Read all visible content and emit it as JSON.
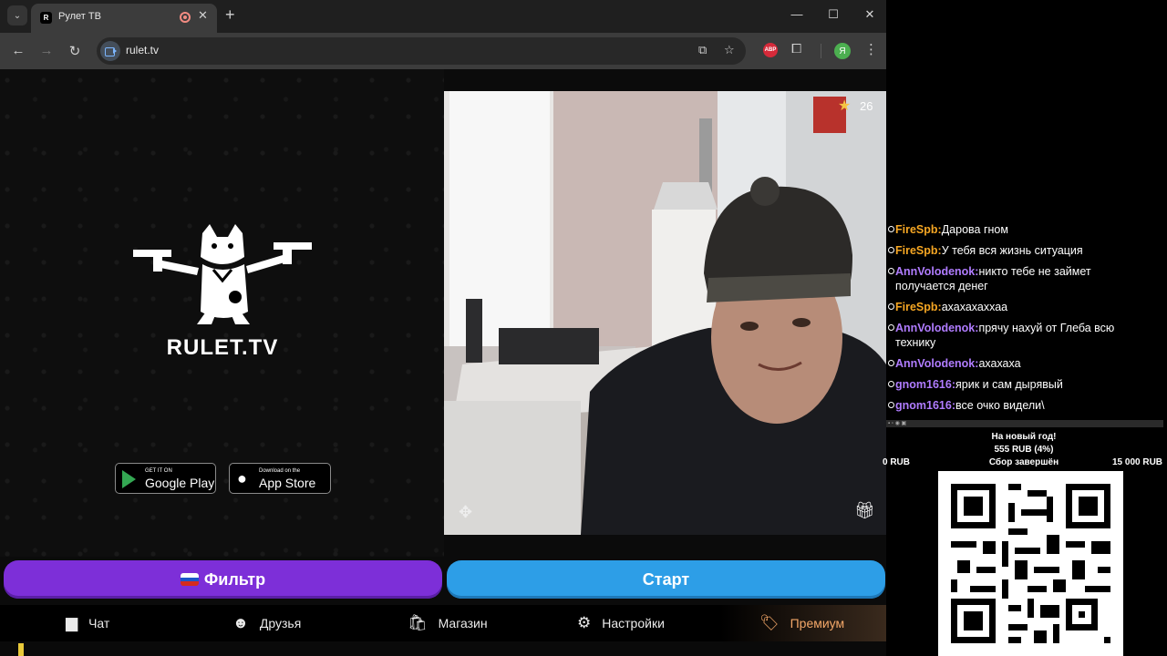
{
  "browser": {
    "tab_title": "Рулет ТВ",
    "tab_favicon": "r-logo",
    "url": "rulet.tv",
    "profile_initial": "Я",
    "ext_abp_label": "ABP",
    "controls": {
      "minimize": "—",
      "maximize": "☐",
      "close": "✕",
      "back": "←",
      "forward": "→",
      "reload": "↻",
      "new_tab": "+",
      "tab_close": "✕",
      "menu": "⋮",
      "tab_search": "⌄"
    }
  },
  "app": {
    "brand": "RULET.TV",
    "google_play": {
      "small": "GET IT ON",
      "big": "Google Play"
    },
    "app_store": {
      "small": "Download on the",
      "big": "App Store"
    },
    "stars_count": "26",
    "filter_label": "Фильтр",
    "start_label": "Старт",
    "nav": {
      "chat": "Чат",
      "friends": "Друзья",
      "shop": "Магазин",
      "settings": "Настройки",
      "premium": "Премиум"
    }
  },
  "stream_overlay": {
    "chat": [
      {
        "nick": "FireSpb",
        "nick_color": "#f5a623",
        "text": "Дарова гном"
      },
      {
        "nick": "FireSpb",
        "nick_color": "#f5a623",
        "text": "У тебя вся жизнь ситуация"
      },
      {
        "nick": "AnnVolodenok",
        "nick_color": "#b07cff",
        "text": "никто тебе не займет получается денег"
      },
      {
        "nick": "FireSpb",
        "nick_color": "#f5a623",
        "text": "ахахахаххаа"
      },
      {
        "nick": "AnnVolodenok",
        "nick_color": "#b07cff",
        "text": "прячу нахуй от Глеба всю технику"
      },
      {
        "nick": "AnnVolodenok",
        "nick_color": "#b07cff",
        "text": "ахахаха"
      },
      {
        "nick": "gnom1616",
        "nick_color": "#b07cff",
        "text": "ярик и сам дырявый"
      },
      {
        "nick": "gnom1616",
        "nick_color": "#b07cff",
        "text": "все очко видели\\"
      }
    ],
    "donation": {
      "title": "На новый год!",
      "amount": "555 RUB (4%)",
      "min": "0 RUB",
      "status": "Сбор завершён",
      "max": "15 000 RUB",
      "progress_percent": 4
    }
  },
  "colors": {
    "filter": "#7d2fd8",
    "start": "#2d9ee7",
    "premium": "#f3a768",
    "star": "#f5c542"
  }
}
